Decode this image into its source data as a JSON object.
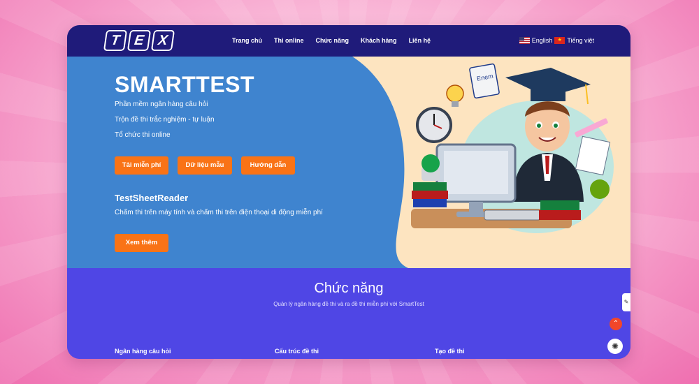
{
  "logo": {
    "letters": [
      "T",
      "E",
      "X"
    ]
  },
  "nav": {
    "items": [
      "Trang chủ",
      "Thi online",
      "Chức năng",
      "Khách hàng",
      "Liên hệ"
    ],
    "lang_en": "English",
    "lang_vi": "Tiếng việt"
  },
  "hero": {
    "title": "SMARTTEST",
    "lines": [
      "Phần mềm ngân hàng câu hỏi",
      "Trộn đề thi trắc nghiệm - tự luận",
      "Tổ chức thi online"
    ],
    "buttons": [
      "Tải miễn phí",
      "Dữ liệu mẫu",
      "Hướng dẫn"
    ],
    "sub_title": "TestSheetReader",
    "sub_desc": "Chấm thi trên máy tính và chấm thi trên điện thoại di động miễn phí",
    "more_button": "Xem thêm",
    "illustration_book_label": "Enem"
  },
  "features": {
    "title": "Chức năng",
    "desc": "Quản lý ngân hàng đề thi và ra đề thi miễn phí với SmartTest",
    "columns": [
      "Ngân hàng câu hỏi",
      "Cấu trúc đề thi",
      "Tạo đề thi"
    ]
  },
  "colors": {
    "nav": "#1f1b7a",
    "hero_blue": "#3f84cf",
    "accent": "#f97316",
    "section": "#4f46e5"
  }
}
